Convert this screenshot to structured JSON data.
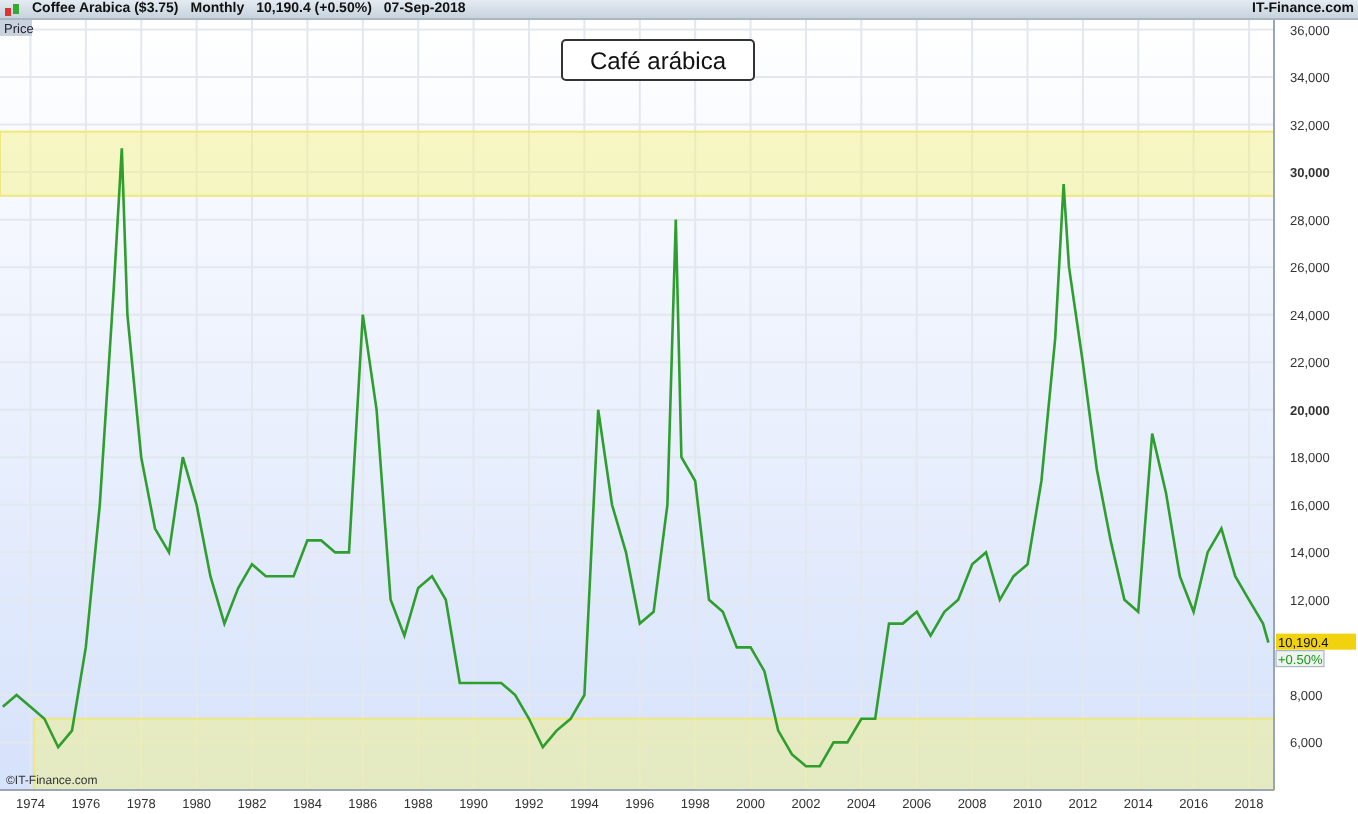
{
  "header": {
    "symbol": "Coffee Arabica ($3.75)",
    "interval": "Monthly",
    "quote": "10,190.4 (+0.50%)",
    "date": "07-Sep-2018",
    "brand": "IT-Finance.com"
  },
  "panel": {
    "label": "Price",
    "copyright": "©IT-Finance.com",
    "last_price": "10,190.4",
    "last_change": "+0.50%",
    "chart_data": {
      "type": "line",
      "title": "Café arábica",
      "x": [
        1973.0,
        1973.5,
        1974,
        1974.5,
        1975,
        1975.5,
        1976,
        1976.5,
        1977,
        1977.3,
        1977.5,
        1978,
        1978.5,
        1979,
        1979.5,
        1980,
        1980.5,
        1981,
        1981.5,
        1982,
        1982.5,
        1983,
        1983.5,
        1984,
        1984.5,
        1985,
        1985.5,
        1986,
        1986.5,
        1987,
        1987.5,
        1988,
        1988.5,
        1989,
        1989.5,
        1990,
        1990.5,
        1991,
        1991.5,
        1992,
        1992.5,
        1993,
        1993.5,
        1994,
        1994.5,
        1995,
        1995.5,
        1996,
        1996.5,
        1997,
        1997.3,
        1997.5,
        1998,
        1998.5,
        1999,
        1999.5,
        2000,
        2000.5,
        2001,
        2001.5,
        2002,
        2002.5,
        2003,
        2003.5,
        2004,
        2004.5,
        2005,
        2005.5,
        2006,
        2006.5,
        2007,
        2007.5,
        2008,
        2008.5,
        2009,
        2009.5,
        2010,
        2010.5,
        2011,
        2011.3,
        2011.5,
        2012,
        2012.5,
        2013,
        2013.5,
        2014,
        2014.5,
        2015,
        2015.5,
        2016,
        2016.5,
        2017,
        2017.5,
        2018,
        2018.5,
        2018.7
      ],
      "grid": true,
      "series": [
        {
          "color": "#2e9e2e",
          "values": [
            7500,
            8000,
            7500,
            7000,
            5800,
            6500,
            10000,
            16000,
            25000,
            31000,
            24000,
            18000,
            15000,
            14000,
            18000,
            16000,
            13000,
            11000,
            12500,
            13500,
            13000,
            13000,
            13000,
            14500,
            14500,
            14000,
            14000,
            24000,
            20000,
            12000,
            10500,
            12500,
            13000,
            12000,
            8500,
            8500,
            8500,
            8500,
            8000,
            7000,
            5800,
            6500,
            7000,
            8000,
            20000,
            16000,
            14000,
            11000,
            11500,
            16000,
            28000,
            18000,
            17000,
            12000,
            11500,
            10000,
            10000,
            9000,
            6500,
            5500,
            5000,
            5000,
            6000,
            6000,
            7000,
            7000,
            11000,
            11000,
            11500,
            10500,
            11500,
            12000,
            13500,
            14000,
            12000,
            13000,
            13500,
            17000,
            23000,
            29500,
            26000,
            22000,
            17500,
            14500,
            12000,
            11500,
            19000,
            16500,
            13000,
            11500,
            14000,
            15000,
            13000,
            12000,
            11000,
            10200
          ]
        }
      ],
      "xlim": [
        1972.9,
        2018.9
      ],
      "ylim": [
        4000,
        36400
      ],
      "xticks": [
        {
          "value": 1974,
          "label": "1974"
        },
        {
          "value": 1976,
          "label": "1976"
        },
        {
          "value": 1978,
          "label": "1978"
        },
        {
          "value": 1980,
          "label": "1980"
        },
        {
          "value": 1982,
          "label": "1982"
        },
        {
          "value": 1984,
          "label": "1984"
        },
        {
          "value": 1986,
          "label": "1986"
        },
        {
          "value": 1988,
          "label": "1988"
        },
        {
          "value": 1990,
          "label": "1990"
        },
        {
          "value": 1992,
          "label": "1992"
        },
        {
          "value": 1994,
          "label": "1994"
        },
        {
          "value": 1996,
          "label": "1996"
        },
        {
          "value": 1998,
          "label": "1998"
        },
        {
          "value": 2000,
          "label": "2000"
        },
        {
          "value": 2002,
          "label": "2002"
        },
        {
          "value": 2004,
          "label": "2004"
        },
        {
          "value": 2006,
          "label": "2006"
        },
        {
          "value": 2008,
          "label": "2008"
        },
        {
          "value": 2010,
          "label": "2010"
        },
        {
          "value": 2012,
          "label": "2012"
        },
        {
          "value": 2014,
          "label": "2014"
        },
        {
          "value": 2016,
          "label": "2016"
        },
        {
          "value": 2018,
          "label": "2018"
        }
      ],
      "yticks": [
        {
          "value": 6000,
          "label": "6,000"
        },
        {
          "value": 8000,
          "label": "8,000"
        },
        {
          "value": 12000,
          "label": "12,000"
        },
        {
          "value": 14000,
          "label": "14,000"
        },
        {
          "value": 16000,
          "label": "16,000"
        },
        {
          "value": 18000,
          "label": "18,000"
        },
        {
          "value": 20000,
          "label": "20,000"
        },
        {
          "value": 22000,
          "label": "22,000"
        },
        {
          "value": 24000,
          "label": "24,000"
        },
        {
          "value": 26000,
          "label": "26,000"
        },
        {
          "value": 28000,
          "label": "28,000"
        },
        {
          "value": 30000,
          "label": "30,000"
        },
        {
          "value": 32000,
          "label": "32,000"
        },
        {
          "value": 34000,
          "label": "34,000"
        },
        {
          "value": 36000,
          "label": "36,000"
        }
      ],
      "bands": [
        {
          "axis": "y",
          "from": 29000,
          "to": 31700
        },
        {
          "axis": "y",
          "from": 4000,
          "to": 7000
        }
      ]
    }
  }
}
